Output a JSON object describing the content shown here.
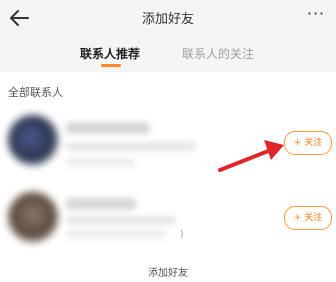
{
  "header": {
    "title": "添加好友",
    "more_label": "···"
  },
  "tabs": [
    {
      "label": "联系人推荐",
      "active": true
    },
    {
      "label": "联系人的关注",
      "active": false
    }
  ],
  "section": {
    "label": "全部联系人"
  },
  "contacts": [
    {
      "follow_label": "+ 关注"
    },
    {
      "follow_label": "+ 关注"
    }
  ],
  "partial_mark": ")",
  "caption": "添加好友",
  "colors": {
    "accent": "#ff8a1f",
    "arrow": "#e0262a",
    "header_bg": "#f5f5f5"
  }
}
